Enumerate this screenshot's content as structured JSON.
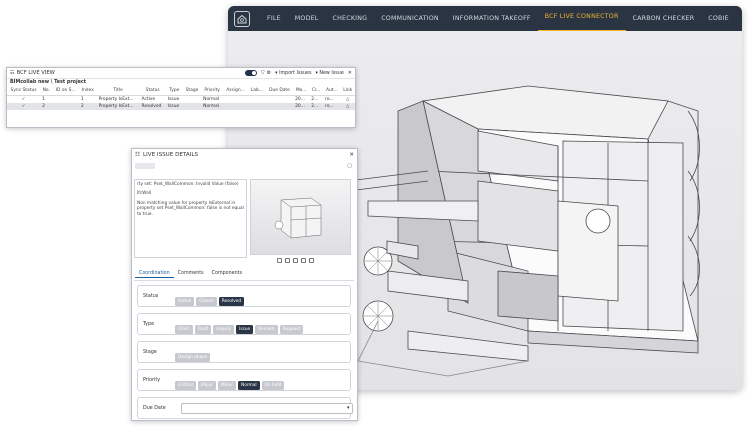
{
  "nav": [
    "FILE",
    "MODEL",
    "CHECKING",
    "COMMUNICATION",
    "INFORMATION TAKEOFF",
    "BCF LIVE CONNECTOR",
    "CARBON CHECKER",
    "COBIE"
  ],
  "active_nav": "BCF LIVE CONNECTOR",
  "bcf_view": {
    "title": "BCF LIVE VIEW",
    "import_label": "Import Issues",
    "new_issue_label": "New Issue",
    "project_label": "BIMcollab new \\ Test project",
    "columns": [
      "Sync Status",
      "No.",
      "ID on S...",
      "Index",
      "Title",
      "Status",
      "Type",
      "Stage",
      "Priority",
      "Assign...",
      "Lab...",
      "Due Date",
      "Mo...",
      "Cr...",
      "Aut...",
      "Link"
    ],
    "rows": [
      {
        "sync": "✓",
        "no": "1",
        "id": "",
        "index": "1",
        "title": "Property IsExt...",
        "status": "Active",
        "type": "Issue",
        "stage": "",
        "priority": "Normal",
        "assign": "",
        "lab": "",
        "due": "",
        "mo": "20...",
        "cr": "2...",
        "aut": "ro...",
        "link": "△"
      },
      {
        "sync": "✓",
        "no": "2",
        "id": "",
        "index": "2",
        "title": "Property IsExt...",
        "status": "Resolved",
        "type": "Issue",
        "stage": "",
        "priority": "Normal",
        "assign": "",
        "lab": "",
        "due": "",
        "mo": "20...",
        "cr": "2...",
        "aut": "ro...",
        "link": "△"
      }
    ]
  },
  "details": {
    "title": "LIVE ISSUE DETAILS",
    "desc_line1": "rty set: Pset_WallCommon: Invalid Value (false)",
    "desc_line2": "IfcWall",
    "desc_line3": "Non matching value for property IsExternal in property set Pset_WallCommon: false is not equal to true.",
    "tabs": [
      "Coordination",
      "Comments",
      "Components"
    ],
    "status": {
      "label": "Status",
      "options": [
        "Active",
        "Closed",
        "Resolved"
      ],
      "selected": "Resolved"
    },
    "type": {
      "label": "Type",
      "options": [
        "Clash",
        "Fault",
        "Inquiry",
        "Issue",
        "Remark",
        "Request"
      ],
      "selected": "Issue"
    },
    "stage": {
      "label": "Stage",
      "options": [
        "Design phase"
      ],
      "selected": ""
    },
    "priority": {
      "label": "Priority",
      "options": [
        "Critical",
        "Major",
        "Minor",
        "Normal",
        "On hold"
      ],
      "selected": "Normal"
    },
    "due": {
      "label": "Due Date",
      "value": ""
    }
  }
}
